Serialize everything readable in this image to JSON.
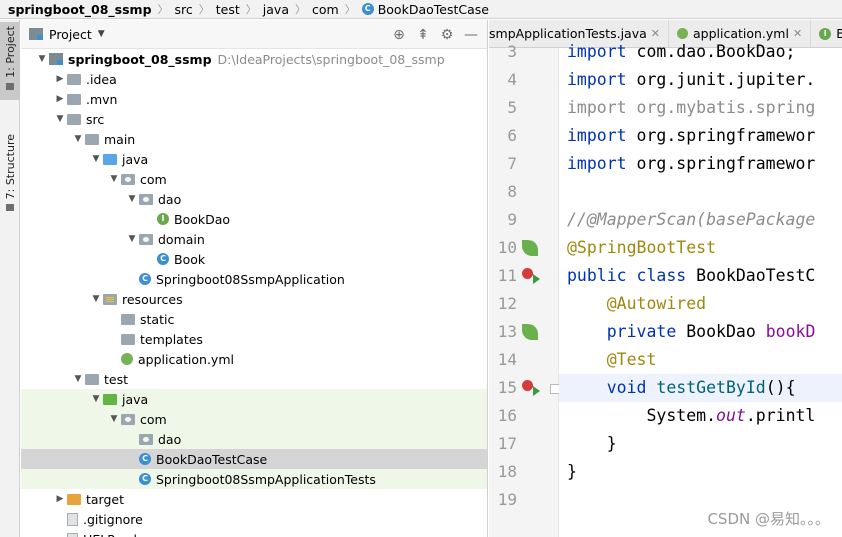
{
  "breadcrumb": {
    "items": [
      "springboot_08_ssmp",
      "src",
      "test",
      "java",
      "com"
    ],
    "current": "BookDaoTestCase",
    "class_icon_letter": "C"
  },
  "toolstrip": {
    "project_label": "1: Project",
    "structure_label": "7: Structure"
  },
  "project_panel": {
    "title": "Project",
    "tools": [
      "target-icon",
      "collapse-icon",
      "gear-icon",
      "minimize-icon"
    ]
  },
  "tree": [
    {
      "label": "springboot_08_ssmp",
      "path": "D:\\IdeaProjects\\springboot_08_ssmp",
      "bold": true,
      "depth": 0,
      "arrow": "open",
      "icon": "module"
    },
    {
      "label": ".idea",
      "depth": 1,
      "arrow": "closed",
      "icon": "folder"
    },
    {
      "label": ".mvn",
      "depth": 1,
      "arrow": "closed",
      "icon": "folder"
    },
    {
      "label": "src",
      "depth": 1,
      "arrow": "open",
      "icon": "folder"
    },
    {
      "label": "main",
      "depth": 2,
      "arrow": "open",
      "icon": "folder"
    },
    {
      "label": "java",
      "depth": 3,
      "arrow": "open",
      "icon": "folder-blue"
    },
    {
      "label": "com",
      "depth": 4,
      "arrow": "open",
      "icon": "package"
    },
    {
      "label": "dao",
      "depth": 5,
      "arrow": "open",
      "icon": "package"
    },
    {
      "label": "BookDao",
      "depth": 6,
      "arrow": "none",
      "icon": "interface",
      "letter": "I"
    },
    {
      "label": "domain",
      "depth": 5,
      "arrow": "open",
      "icon": "package"
    },
    {
      "label": "Book",
      "depth": 6,
      "arrow": "none",
      "icon": "class",
      "letter": "C"
    },
    {
      "label": "Springboot08SsmpApplication",
      "depth": 5,
      "arrow": "none",
      "icon": "class",
      "letter": "C"
    },
    {
      "label": "resources",
      "depth": 3,
      "arrow": "open",
      "icon": "folder-res"
    },
    {
      "label": "static",
      "depth": 4,
      "arrow": "none",
      "icon": "folder"
    },
    {
      "label": "templates",
      "depth": 4,
      "arrow": "none",
      "icon": "folder"
    },
    {
      "label": "application.yml",
      "depth": 4,
      "arrow": "none",
      "icon": "yml"
    },
    {
      "label": "test",
      "depth": 2,
      "arrow": "open",
      "icon": "folder"
    },
    {
      "label": "java",
      "depth": 3,
      "arrow": "open",
      "icon": "folder-green",
      "test": true
    },
    {
      "label": "com",
      "depth": 4,
      "arrow": "open",
      "icon": "package",
      "test": true
    },
    {
      "label": "dao",
      "depth": 5,
      "arrow": "none",
      "icon": "package",
      "test": true
    },
    {
      "label": "BookDaoTestCase",
      "depth": 5,
      "arrow": "none",
      "icon": "class",
      "letter": "C",
      "selected": true
    },
    {
      "label": "Springboot08SsmpApplicationTests",
      "depth": 5,
      "arrow": "none",
      "icon": "class",
      "letter": "C",
      "test": true
    },
    {
      "label": "target",
      "depth": 1,
      "arrow": "closed",
      "icon": "folder-orange"
    },
    {
      "label": ".gitignore",
      "depth": 1,
      "arrow": "none",
      "icon": "file"
    },
    {
      "label": "HELP.md",
      "depth": 1,
      "arrow": "none",
      "icon": "file"
    }
  ],
  "editor": {
    "tabs": [
      {
        "label": "smpApplicationTests.java",
        "icon": "class",
        "closable": true
      },
      {
        "label": "application.yml",
        "icon": "yml",
        "closable": true
      },
      {
        "label": "Boo",
        "icon": "interface",
        "letter": "I",
        "closable": false
      }
    ],
    "lines": [
      {
        "n": "3",
        "tokens": [
          {
            "t": "import ",
            "c": "kw"
          },
          {
            "t": "com.dao.BookDao;",
            "c": "pk"
          }
        ]
      },
      {
        "n": "4",
        "tokens": [
          {
            "t": "import ",
            "c": "kw"
          },
          {
            "t": "org.junit.jupiter.",
            "c": "pk"
          }
        ]
      },
      {
        "n": "5",
        "tokens": [
          {
            "t": "import ",
            "c": "gray"
          },
          {
            "t": "org.mybatis.spring",
            "c": "gray"
          }
        ]
      },
      {
        "n": "6",
        "tokens": [
          {
            "t": "import ",
            "c": "kw"
          },
          {
            "t": "org.springframewor",
            "c": "pk"
          }
        ]
      },
      {
        "n": "7",
        "tokens": [
          {
            "t": "import ",
            "c": "kw"
          },
          {
            "t": "org.springframewor",
            "c": "pk"
          }
        ]
      },
      {
        "n": "8",
        "tokens": []
      },
      {
        "n": "9",
        "tokens": [
          {
            "t": "//@MapperScan(basePackage",
            "c": "cm"
          }
        ]
      },
      {
        "n": "10",
        "mark": "leaf",
        "tokens": [
          {
            "t": "@SpringBootTest",
            "c": "an"
          }
        ]
      },
      {
        "n": "11",
        "mark": "run",
        "tokens": [
          {
            "t": "public class ",
            "c": "kw"
          },
          {
            "t": "BookDaoTestC",
            "c": "pk"
          }
        ]
      },
      {
        "n": "12",
        "tokens": [
          {
            "t": "    ",
            "c": "pk"
          },
          {
            "t": "@Autowired",
            "c": "an"
          }
        ]
      },
      {
        "n": "13",
        "mark": "leaf",
        "tokens": [
          {
            "t": "    ",
            "c": "pk"
          },
          {
            "t": "private ",
            "c": "kw"
          },
          {
            "t": "BookDao ",
            "c": "pk"
          },
          {
            "t": "bookD",
            "c": "fld"
          }
        ]
      },
      {
        "n": "14",
        "tokens": [
          {
            "t": "    ",
            "c": "pk"
          },
          {
            "t": "@Test",
            "c": "an"
          }
        ]
      },
      {
        "n": "15",
        "mark": "run",
        "highlight": true,
        "tokens": [
          {
            "t": "    ",
            "c": "pk"
          },
          {
            "t": "void ",
            "c": "kw"
          },
          {
            "t": "testGetById",
            "c": "mth"
          },
          {
            "t": "(){",
            "c": "pk"
          }
        ]
      },
      {
        "n": "16",
        "tokens": [
          {
            "t": "        System.",
            "c": "pk"
          },
          {
            "t": "out",
            "c": "st"
          },
          {
            "t": ".printl",
            "c": "pk"
          }
        ]
      },
      {
        "n": "17",
        "tokens": [
          {
            "t": "    }",
            "c": "pk"
          }
        ]
      },
      {
        "n": "18",
        "tokens": [
          {
            "t": "}",
            "c": "pk"
          }
        ]
      },
      {
        "n": "19",
        "tokens": []
      }
    ]
  },
  "watermark": "CSDN @易知。。。"
}
